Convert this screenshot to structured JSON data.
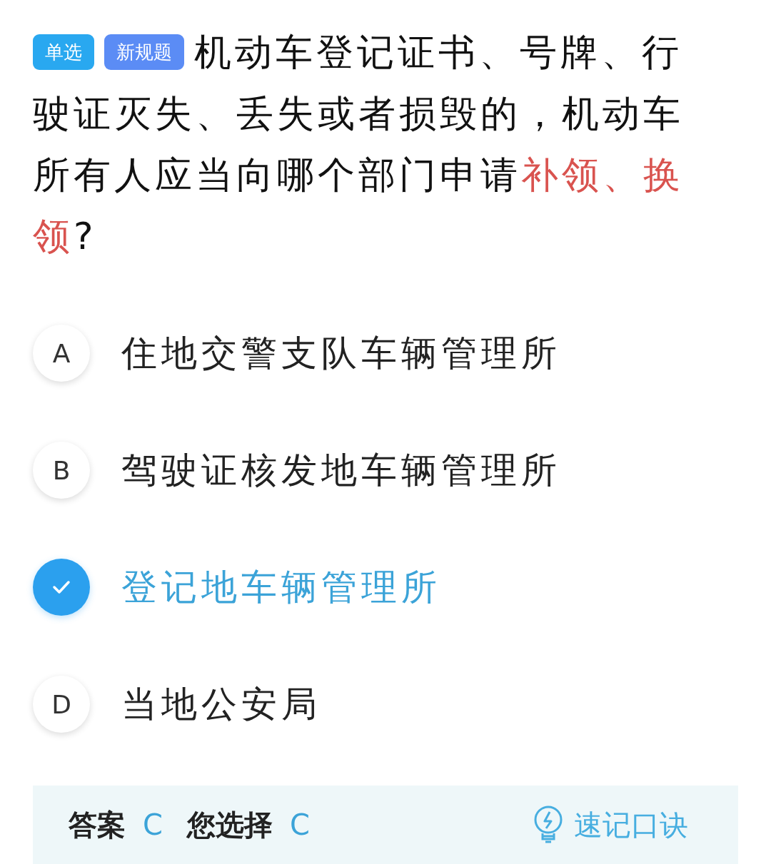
{
  "question": {
    "tags": [
      {
        "label": "单选",
        "color": "#29a8f0"
      },
      {
        "label": "新规题",
        "color": "#5b8cf5"
      }
    ],
    "lines": [
      [
        {
          "text": "机动车登记证书、号牌、行",
          "highlight": false
        }
      ],
      [
        {
          "text": "驶证灭失、丢失或者损毁的，机动车",
          "highlight": false
        }
      ],
      [
        {
          "text": "所有人应当向哪个部门申请",
          "highlight": false
        },
        {
          "text": "补领、换",
          "highlight": true
        }
      ],
      [
        {
          "text": "领",
          "highlight": true
        },
        {
          "text": "?",
          "highlight": false
        }
      ]
    ]
  },
  "options": [
    {
      "letter": "A",
      "text": "住地交警支队车辆管理所",
      "selected": false
    },
    {
      "letter": "B",
      "text": "驾驶证核发地车辆管理所",
      "selected": false
    },
    {
      "text": "登记地车辆管理所",
      "selected": true
    },
    {
      "letter": "D",
      "text": "当地公安局",
      "selected": false
    }
  ],
  "answer_panel": {
    "answer_label": "答案",
    "answer": "C",
    "choice_label": "您选择",
    "choice": "C",
    "hint": "速记口诀"
  }
}
